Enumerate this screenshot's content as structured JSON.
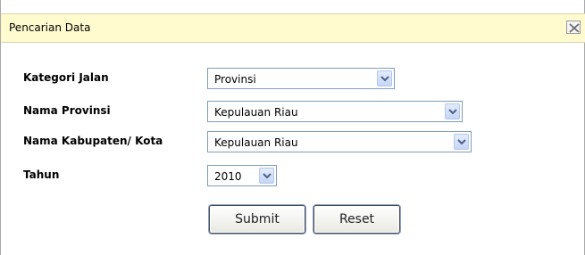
{
  "dialog": {
    "title": "Pencarian Data"
  },
  "form": {
    "kategori_label": "Kategori Jalan",
    "kategori_value": "Provinsi",
    "provinsi_label": "Nama Provinsi",
    "provinsi_value": "Kepulauan Riau",
    "kabupaten_label": "Nama Kabupaten/ Kota",
    "kabupaten_value": "Kepulauan Riau",
    "tahun_label": "Tahun",
    "tahun_value": "2010"
  },
  "buttons": {
    "submit": "Submit",
    "reset": "Reset"
  },
  "icons": {
    "close": "close-icon",
    "dropdown": "chevron-down-icon"
  },
  "colors": {
    "titlebar_bg": "#fffbcf",
    "select_border": "#7f9db9",
    "arrow_button": "#c5d6f7",
    "arrow_glyph": "#4d6185"
  }
}
